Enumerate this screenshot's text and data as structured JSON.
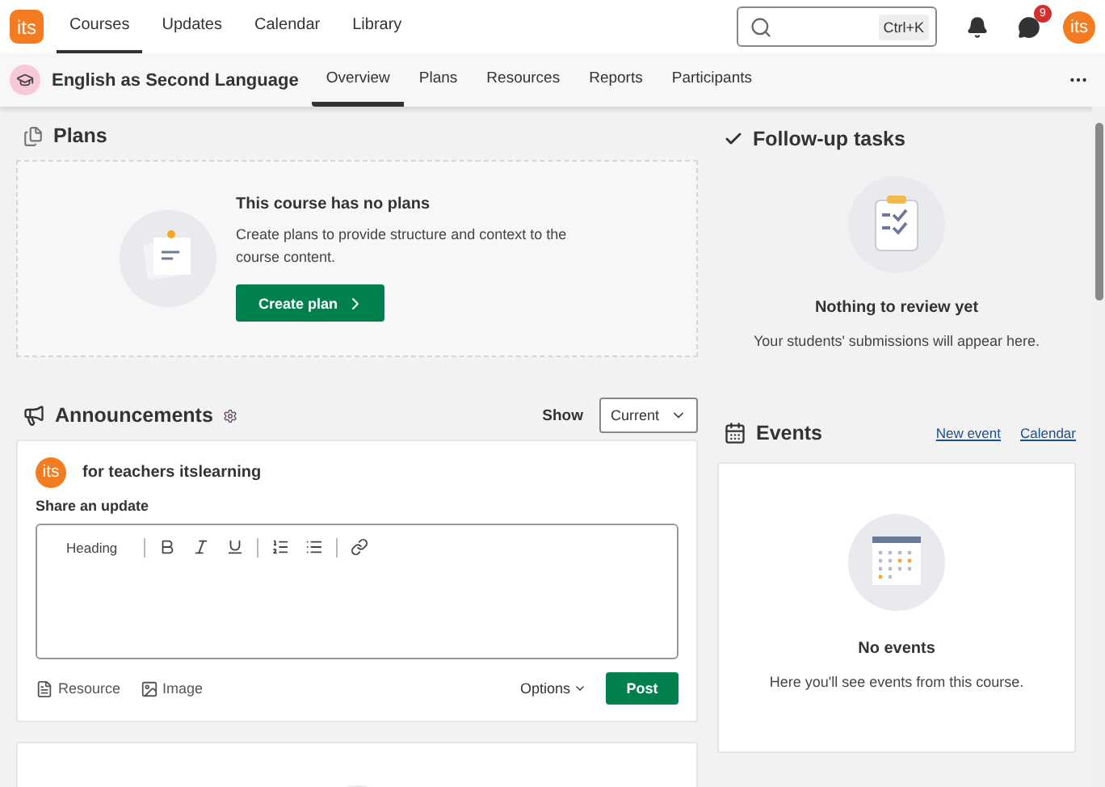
{
  "topnav": {
    "logo": "its",
    "items": [
      {
        "label": "Courses",
        "selected": true
      },
      {
        "label": "Updates",
        "selected": false
      },
      {
        "label": "Calendar",
        "selected": false
      },
      {
        "label": "Library",
        "selected": false
      }
    ],
    "search": {
      "shortcut": "Ctrl+K"
    },
    "notification_badge": "9",
    "avatar": "its"
  },
  "course_bar": {
    "title": "English as Second Language",
    "tabs": [
      {
        "label": "Overview",
        "selected": true
      },
      {
        "label": "Plans",
        "selected": false
      },
      {
        "label": "Resources",
        "selected": false
      },
      {
        "label": "Reports",
        "selected": false
      },
      {
        "label": "Participants",
        "selected": false
      }
    ]
  },
  "plans": {
    "title": "Plans",
    "empty_title": "This course has no plans",
    "empty_text": "Create plans to provide structure and context to the course content.",
    "button": "Create plan"
  },
  "announcements": {
    "title": "Announcements",
    "show_label": "Show",
    "show_value": "Current",
    "author_avatar": "its",
    "author": "for teachers itslearning",
    "share_label": "Share an update",
    "heading_label": "Heading",
    "attachments": [
      {
        "kind": "resource",
        "label": "Resource"
      },
      {
        "kind": "image",
        "label": "Image"
      }
    ],
    "options": "Options",
    "post": "Post"
  },
  "follow_up": {
    "title": "Follow-up tasks",
    "empty_title": "Nothing to review yet",
    "empty_text": "Your students' submissions will appear here."
  },
  "events": {
    "title": "Events",
    "links": [
      "New event",
      "Calendar"
    ],
    "empty_title": "No events",
    "empty_text": "Here you'll see events from this course."
  }
}
